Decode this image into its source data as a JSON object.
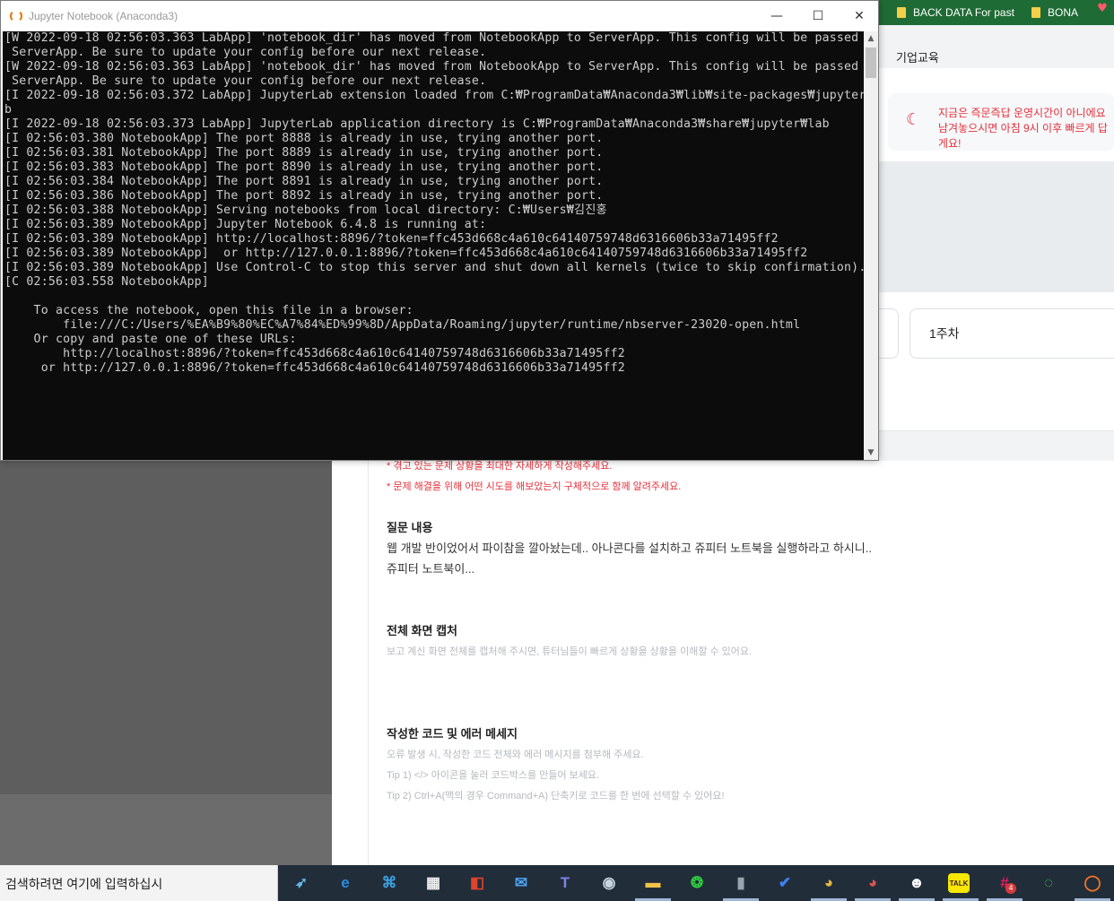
{
  "browser": {
    "bookmarks": [
      "BACK DATA For past",
      "BONA"
    ],
    "nav_item": "기업교육"
  },
  "page": {
    "notice_text": "지금은 즉문즉답 운영시간이 아니에요\n남겨놓으시면 아침 9시 이후 빠르게 답\n게요!",
    "week_label": "1주차",
    "hints_red": [
      "* 겪고 있는 문제 상황을 최대한 자세하게 작성해주세요.",
      "* 문제 해결을 위해 어떤 시도를 해보았는지 구체적으로 함께 알려주세요."
    ],
    "question": {
      "title": "질문 내용",
      "lines": [
        "웹 개발 반이었어서 파이참을 깔아놨는데.. 아나콘다를 설치하고 쥬피터 노트북을 실행하라고 하시니..",
        "쥬피터 노트북이..."
      ]
    },
    "capture": {
      "title": "전체 화면 캡처",
      "hint": "보고 계신 화면 전체를 캡처해 주시면, 튜터님들이 빠르게 상황을 상황을 이해할 수 있어요."
    },
    "code": {
      "title": "작성한 코드 및 에러 메세지",
      "hints": [
        "오류 발생 시, 작성한 코드 전체와 에러 메시지를 첨부해 주세요.",
        "Tip 1) </> 아이콘을 눌러 코드박스를 만들어 보세요.",
        "Tip 2) Ctrl+A(맥의 경우 Command+A) 단축키로 코드를 한 번에 선택할 수 있어요!"
      ]
    }
  },
  "console": {
    "title": "Jupyter Notebook (Anaconda3)",
    "buttons": {
      "minimize": "—",
      "maximize": "☐",
      "close": "✕"
    },
    "lines": [
      "[W 2022-09-18 02:56:03.363 LabApp] 'notebook_dir' has moved from NotebookApp to ServerApp. This config will be passed to",
      " ServerApp. Be sure to update your config before our next release.",
      "[W 2022-09-18 02:56:03.363 LabApp] 'notebook_dir' has moved from NotebookApp to ServerApp. This config will be passed to",
      " ServerApp. Be sure to update your config before our next release.",
      "[I 2022-09-18 02:56:03.372 LabApp] JupyterLab extension loaded from C:₩ProgramData₩Anaconda3₩lib₩site-packages₩jupyterla",
      "b",
      "[I 2022-09-18 02:56:03.373 LabApp] JupyterLab application directory is C:₩ProgramData₩Anaconda3₩share₩jupyter₩lab",
      "[I 02:56:03.380 NotebookApp] The port 8888 is already in use, trying another port.",
      "[I 02:56:03.381 NotebookApp] The port 8889 is already in use, trying another port.",
      "[I 02:56:03.383 NotebookApp] The port 8890 is already in use, trying another port.",
      "[I 02:56:03.384 NotebookApp] The port 8891 is already in use, trying another port.",
      "[I 02:56:03.386 NotebookApp] The port 8892 is already in use, trying another port.",
      "[I 02:56:03.388 NotebookApp] Serving notebooks from local directory: C:₩Users₩김진홍",
      "[I 02:56:03.389 NotebookApp] Jupyter Notebook 6.4.8 is running at:",
      "[I 02:56:03.389 NotebookApp] http://localhost:8896/?token=ffc453d668c4a610c64140759748d6316606b33a71495ff2",
      "[I 02:56:03.389 NotebookApp]  or http://127.0.0.1:8896/?token=ffc453d668c4a610c64140759748d6316606b33a71495ff2",
      "[I 02:56:03.389 NotebookApp] Use Control-C to stop this server and shut down all kernels (twice to skip confirmation).",
      "[C 02:56:03.558 NotebookApp]",
      "",
      "    To access the notebook, open this file in a browser:",
      "        file:///C:/Users/%EA%B9%80%EC%A7%84%ED%99%8D/AppData/Roaming/jupyter/runtime/nbserver-23020-open.html",
      "    Or copy and paste one of these URLs:",
      "        http://localhost:8896/?token=ffc453d668c4a610c64140759748d6316606b33a71495ff2",
      "     or http://127.0.0.1:8896/?token=ffc453d668c4a610c64140759748d6316606b33a71495ff2"
    ]
  },
  "taskbar": {
    "search_placeholder": "검색하려면 여기에 입력하십시",
    "apps": [
      {
        "name": "bird-app-icon",
        "glyph": "➶",
        "color": "#5fb8e8"
      },
      {
        "name": "internet-explorer-icon",
        "glyph": "e",
        "color": "#2a8ce0"
      },
      {
        "name": "translator-icon",
        "glyph": "⌘",
        "color": "#3aa0e0"
      },
      {
        "name": "microsoft-store-icon",
        "glyph": "▦",
        "color": "#f0f0f0"
      },
      {
        "name": "office-icon",
        "glyph": "◧",
        "color": "#e0452b"
      },
      {
        "name": "mail-icon",
        "glyph": "✉",
        "color": "#4aa3f0"
      },
      {
        "name": "teams-icon",
        "glyph": "T",
        "color": "#7b83eb"
      },
      {
        "name": "steam-icon",
        "glyph": "◉",
        "color": "#c7d5e0"
      },
      {
        "name": "file-explorer-icon",
        "glyph": "▬",
        "color": "#f2c34a"
      },
      {
        "name": "green-app-icon",
        "glyph": "❂",
        "color": "#2ecc40"
      },
      {
        "name": "recorder-icon",
        "glyph": "▮",
        "color": "#9aa4ad"
      },
      {
        "name": "todo-icon",
        "glyph": "✔",
        "color": "#3b82f6"
      },
      {
        "name": "chrome-icon",
        "glyph": "◕",
        "color": "#e3b341"
      },
      {
        "name": "chrome-profile-icon",
        "glyph": "◕",
        "color": "#d9534f"
      },
      {
        "name": "penguin-app-icon",
        "glyph": "☻",
        "color": "#ffffff"
      },
      {
        "name": "kakaotalk-icon",
        "glyph": "TALK",
        "color": "#3c1e1e"
      },
      {
        "name": "slack-icon",
        "glyph": "#",
        "color": "#e01e5a"
      },
      {
        "name": "loading-ring-icon",
        "glyph": "◌",
        "color": "#2ecc40"
      },
      {
        "name": "jupyter-icon",
        "glyph": "◯",
        "color": "#f37626"
      }
    ],
    "slack_badge": "4"
  }
}
